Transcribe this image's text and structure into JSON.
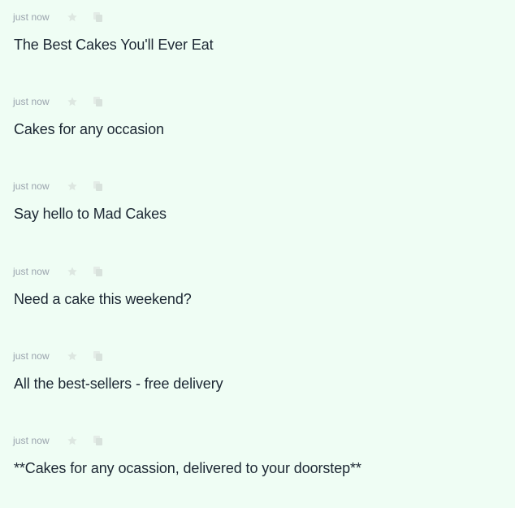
{
  "items": [
    {
      "time": "just now",
      "text": "The Best Cakes You'll Ever Eat"
    },
    {
      "time": "just now",
      "text": "Cakes for any occasion"
    },
    {
      "time": "just now",
      "text": "Say hello to Mad Cakes"
    },
    {
      "time": "just now",
      "text": "Need a cake this weekend?"
    },
    {
      "time": "just now",
      "text": "All the best-sellers - free delivery"
    },
    {
      "time": "just now",
      "text": "**Cakes for any ocassion, delivered to your doorstep**"
    }
  ],
  "colors": {
    "background": "#effdf4",
    "timestamp": "#9aa3ad",
    "headline": "#1c2733",
    "icon": "#dde7e1"
  },
  "icons": {
    "favorite": "star-icon",
    "copy": "copy-icon"
  }
}
